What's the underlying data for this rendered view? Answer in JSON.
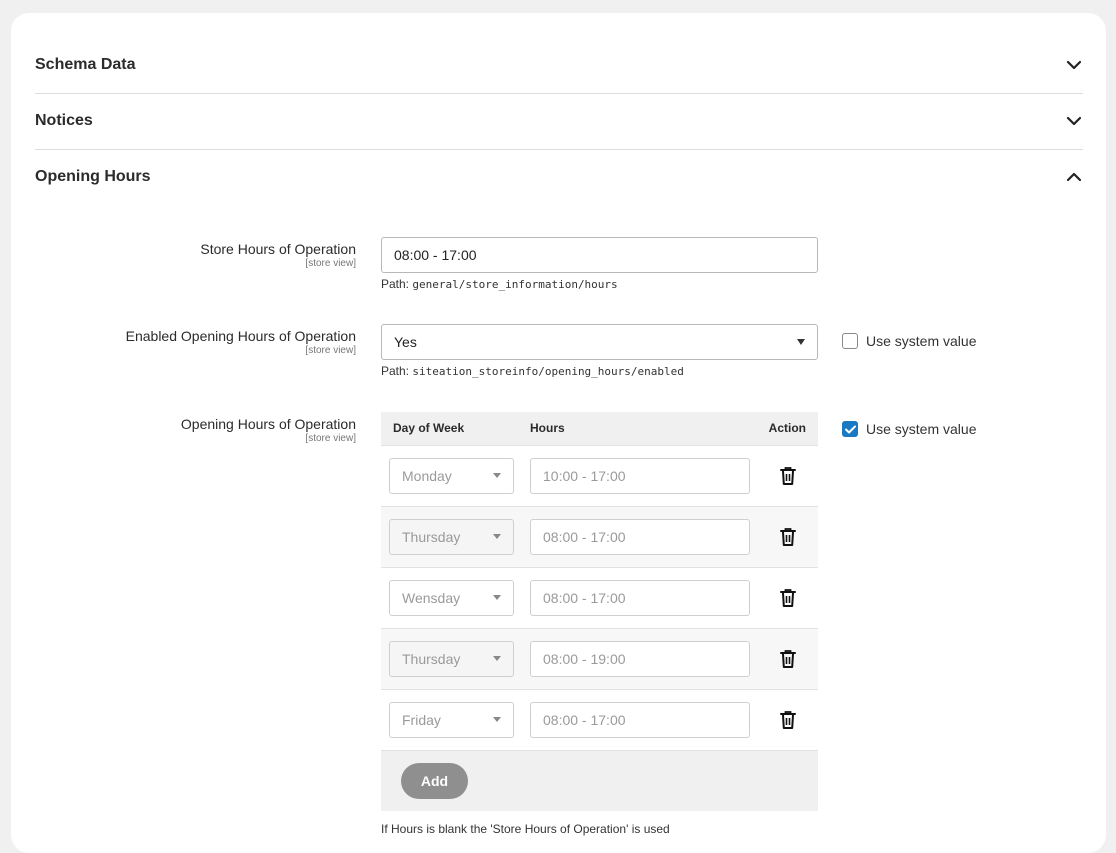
{
  "sections": [
    {
      "title": "Schema Data",
      "state": "collapsed"
    },
    {
      "title": "Notices",
      "state": "collapsed"
    },
    {
      "title": "Opening Hours",
      "state": "expanded"
    }
  ],
  "store_hours": {
    "label": "Store Hours of Operation",
    "scope": "[store view]",
    "value": "08:00 - 17:00",
    "path_prefix": "Path:",
    "path": "general/store_information/hours"
  },
  "enabled": {
    "label": "Enabled Opening Hours of Operation",
    "scope": "[store view]",
    "value": "Yes",
    "path_prefix": "Path:",
    "path": "siteation_storeinfo/opening_hours/enabled",
    "use_system_label": "Use system value",
    "use_system_checked": false
  },
  "opening_hours": {
    "label": "Opening Hours of Operation",
    "scope": "[store view]",
    "use_system_label": "Use system value",
    "use_system_checked": true,
    "columns": [
      "Day of Week",
      "Hours",
      "Action"
    ],
    "rows": [
      {
        "day": "Monday",
        "hours": "10:00 - 17:00"
      },
      {
        "day": "Thursday",
        "hours": "08:00 - 17:00"
      },
      {
        "day": "Wensday",
        "hours": "08:00 - 17:00"
      },
      {
        "day": "Thursday",
        "hours": "08:00 - 19:00"
      },
      {
        "day": "Friday",
        "hours": "08:00 - 17:00"
      }
    ],
    "add_label": "Add",
    "note": "If Hours is blank the 'Store Hours of Operation' is used"
  },
  "icons": {
    "collapse": "chevron-down-icon",
    "expand": "chevron-up-icon",
    "delete": "trash-icon",
    "check": "check-icon"
  },
  "colors": {
    "accent": "#1979c3",
    "add_button": "#8f8f8f",
    "page_bg": "#f0f0f0"
  }
}
